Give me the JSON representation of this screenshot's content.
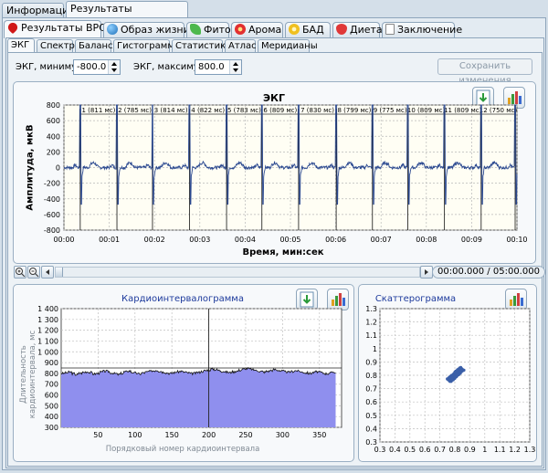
{
  "top_tabs": [
    "Информация",
    "Результаты обследования"
  ],
  "section_tabs": [
    {
      "label": "Результаты ВРС",
      "icon": "heart-icon",
      "color": "#d01818"
    },
    {
      "label": "Образ жизни",
      "icon": "globe-icon",
      "color": "#1e8ad8"
    },
    {
      "label": "Фито",
      "icon": "leaf-icon",
      "color": "#4db84d"
    },
    {
      "label": "Арома",
      "icon": "flower-icon",
      "color": "#e23030"
    },
    {
      "label": "БАД",
      "icon": "pill-icon",
      "color": "#f0c020"
    },
    {
      "label": "Диета",
      "icon": "strawberry-icon",
      "color": "#e03838"
    },
    {
      "label": "Заключение",
      "icon": "document-icon",
      "color": "#ffffff"
    }
  ],
  "analysis_tabs": [
    "ЭКГ",
    "Спектр",
    "Баланс",
    "Гистограмма",
    "Статистика",
    "Атлас",
    "Меридианы"
  ],
  "controls": {
    "min_label": "ЭКГ, минимум",
    "min_value": "-800.0",
    "max_label": "ЭКГ, максимун",
    "max_value": "800.0",
    "save_button": "Сохранить изменения"
  },
  "ecg": {
    "title": "ЭКГ",
    "ylabel": "Амплитуда, мкВ",
    "xlabel": "Время, мин:сек",
    "time_display": "00:00.000 / 05:00.000"
  },
  "cardio": {
    "title": "Кардиоинтервалограмма",
    "ylabel": "Длительность кардиоинтервала, мс",
    "xlabel": "Порядковый номер кардиоинтервала"
  },
  "scatter": {
    "title": "Скаттерограмма"
  },
  "chart_data": [
    {
      "type": "line",
      "title": "ЭКГ",
      "xlabel": "Время, мин:сек",
      "ylabel": "Амплитуда, мкВ",
      "ylim": [
        -800,
        800
      ],
      "y_ticks": [
        800,
        600,
        400,
        200,
        0,
        -200,
        -400,
        -600,
        -800
      ],
      "x_ticks": [
        "00:00",
        "00:01",
        "00:02",
        "00:03",
        "00:04",
        "00:05",
        "00:06",
        "00:07",
        "00:08",
        "00:09",
        "00:10"
      ],
      "x_range_s": [
        0,
        10
      ],
      "r_peaks_s": [
        0.36,
        1.17,
        1.955,
        2.77,
        3.59,
        4.37,
        5.18,
        6.01,
        6.81,
        7.59,
        8.4,
        9.21,
        9.96
      ],
      "intervals": [
        "1 (811 мс)",
        "2 (785 мс)",
        "3 (814 мс)",
        "4 (822 мс)",
        "5 (783 мс)",
        "6 (809 мс)",
        "7 (830 мс)",
        "8 (799 мс)",
        "9 (775 мс)",
        "10 (809 мс)",
        "11 (809 мс)",
        "12 (750 мс)"
      ],
      "r_amplitude": 800,
      "s_amplitude": -470,
      "grid": true
    },
    {
      "type": "area",
      "title": "Кардиоинтервалограмма",
      "xlabel": "Порядковый номер кардиоинтервала",
      "ylabel": "Длительность кардиоинтервала, мс",
      "ylim": [
        300,
        1400
      ],
      "xlim": [
        0,
        380
      ],
      "y_ticks": [
        1400,
        1300,
        1200,
        1100,
        1000,
        900,
        800,
        700,
        600,
        500,
        400,
        300
      ],
      "x_ticks": [
        50,
        100,
        150,
        200,
        250,
        300,
        350
      ],
      "series": [
        {
          "values": [
            800,
            805,
            812,
            798,
            790,
            802,
            810,
            815,
            808,
            795,
            800,
            812,
            820,
            818,
            805,
            798,
            790,
            800,
            815,
            822,
            810,
            802,
            795,
            805,
            812,
            818,
            825,
            830,
            820,
            812,
            805,
            800,
            808,
            815,
            820,
            812,
            805,
            798,
            802,
            810,
            818,
            825,
            832,
            840,
            835,
            828,
            820,
            812,
            808,
            815,
            822,
            830,
            838,
            845,
            840,
            832,
            825,
            818,
            812,
            820,
            828,
            835,
            830,
            822,
            815,
            810,
            818,
            825,
            820,
            812,
            805,
            800,
            808,
            815,
            810,
            802,
            798,
            805,
            812,
            808
          ]
        }
      ],
      "reference_line": 850,
      "marker_x": 200,
      "grid": true
    },
    {
      "type": "scatter",
      "title": "Скаттерограмма",
      "xlim": [
        0.3,
        1.3
      ],
      "ylim": [
        0.3,
        1.3
      ],
      "x_ticks": [
        0.3,
        0.4,
        0.5,
        0.6,
        0.7,
        0.8,
        0.9,
        1,
        1.1,
        1.2,
        1.3
      ],
      "y_ticks": [
        1.3,
        1.2,
        1.1,
        1,
        0.9,
        0.8,
        0.7,
        0.6,
        0.5,
        0.4,
        0.3
      ],
      "cluster": {
        "x_range": [
          0.75,
          0.86
        ],
        "y_range": [
          0.75,
          0.86
        ]
      },
      "grid": true
    }
  ]
}
